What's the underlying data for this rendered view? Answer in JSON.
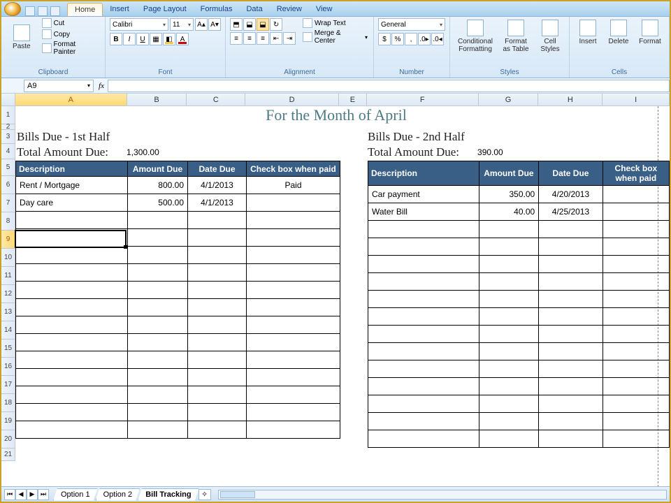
{
  "tabs": [
    "Home",
    "Insert",
    "Page Layout",
    "Formulas",
    "Data",
    "Review",
    "View"
  ],
  "activeTab": "Home",
  "clipboard": {
    "paste": "Paste",
    "cut": "Cut",
    "copy": "Copy",
    "painter": "Format Painter",
    "label": "Clipboard"
  },
  "font": {
    "name": "Calibri",
    "size": "11",
    "label": "Font"
  },
  "alignment": {
    "wrap": "Wrap Text",
    "merge": "Merge & Center",
    "label": "Alignment"
  },
  "number": {
    "format": "General",
    "label": "Number"
  },
  "styles": {
    "cond": "Conditional Formatting",
    "table": "Format as Table",
    "cell": "Cell Styles",
    "label": "Styles"
  },
  "cells": {
    "insert": "Insert",
    "delete": "Delete",
    "format": "Format",
    "label": "Cells"
  },
  "namebox": "A9",
  "cols": [
    {
      "l": "A",
      "w": 160
    },
    {
      "l": "B",
      "w": 86
    },
    {
      "l": "C",
      "w": 84
    },
    {
      "l": "D",
      "w": 134
    },
    {
      "l": "E",
      "w": 40
    },
    {
      "l": "F",
      "w": 160
    },
    {
      "l": "G",
      "w": 86
    },
    {
      "l": "H",
      "w": 92
    },
    {
      "l": "I",
      "w": 96
    }
  ],
  "activeColIdx": 0,
  "activeRow": 9,
  "rowCount": 21,
  "sheetTitle": "For the Month of April",
  "left": {
    "heading": "Bills Due - 1st Half",
    "totalLabel": "Total Amount Due:",
    "total": "1,300.00",
    "headers": [
      "Description",
      "Amount Due",
      "Date Due",
      "Check box when paid"
    ],
    "rows": [
      {
        "desc": "Rent / Mortgage",
        "amt": "800.00",
        "date": "4/1/2013",
        "paid": "Paid"
      },
      {
        "desc": "Day care",
        "amt": "500.00",
        "date": "4/1/2013",
        "paid": ""
      }
    ]
  },
  "right": {
    "heading": "Bills Due - 2nd Half",
    "totalLabel": "Total Amount Due:",
    "total": "390.00",
    "headers": [
      "Description",
      "Amount Due",
      "Date Due",
      "Check box when paid"
    ],
    "rows": [
      {
        "desc": "Car payment",
        "amt": "350.00",
        "date": "4/20/2013",
        "paid": ""
      },
      {
        "desc": "Water Bill",
        "amt": "40.00",
        "date": "4/25/2013",
        "paid": ""
      }
    ]
  },
  "sheetTabs": [
    "Option 1",
    "Option 2",
    "Bill Tracking"
  ],
  "activeSheet": "Bill Tracking"
}
